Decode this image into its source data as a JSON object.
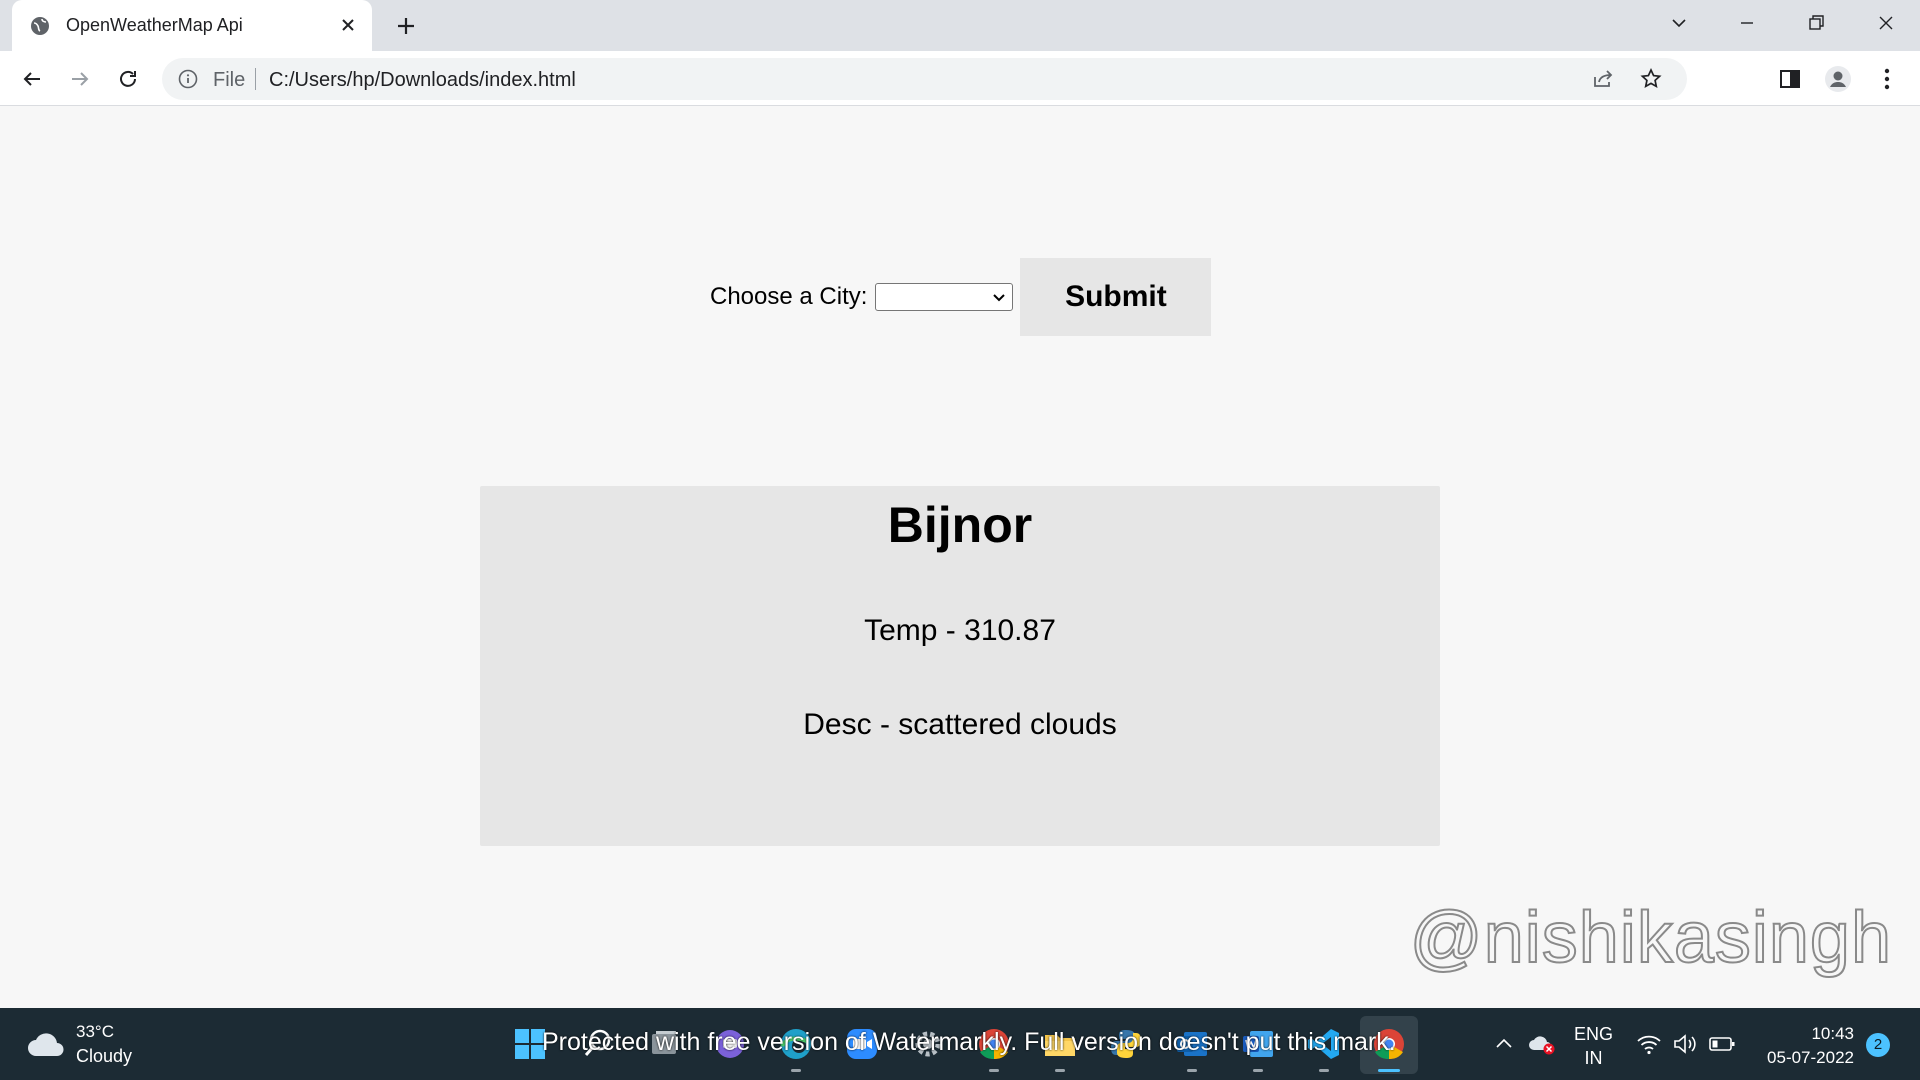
{
  "browser": {
    "tab": {
      "title": "OpenWeatherMap Api"
    },
    "address_bar": {
      "scheme_label": "File",
      "url": "C:/Users/hp/Downloads/index.html"
    }
  },
  "page": {
    "form": {
      "city_label": "Choose a City:",
      "city_select_value": "",
      "submit_label": "Submit"
    },
    "weather_card": {
      "city": "Bijnor",
      "temp_text": "Temp - 310.87",
      "desc_text": "Desc - scattered clouds"
    },
    "watermark_handle": "@nishikasingh"
  },
  "taskbar": {
    "weather": {
      "temp": "33°C",
      "condition": "Cloudy"
    },
    "watermark_overlay": "Protected with free version of Watermarkly. Full version doesn't put this mark.",
    "tray": {
      "lang_line1": "ENG",
      "lang_line2": "IN",
      "time": "10:43",
      "date": "05-07-2022",
      "notification_count": "2"
    }
  },
  "colors": {
    "page_bg": "#f7f7f7",
    "card_bg": "#e6e6e6",
    "taskbar_bg": "#1c2b34",
    "accent": "#4cc2ff"
  }
}
